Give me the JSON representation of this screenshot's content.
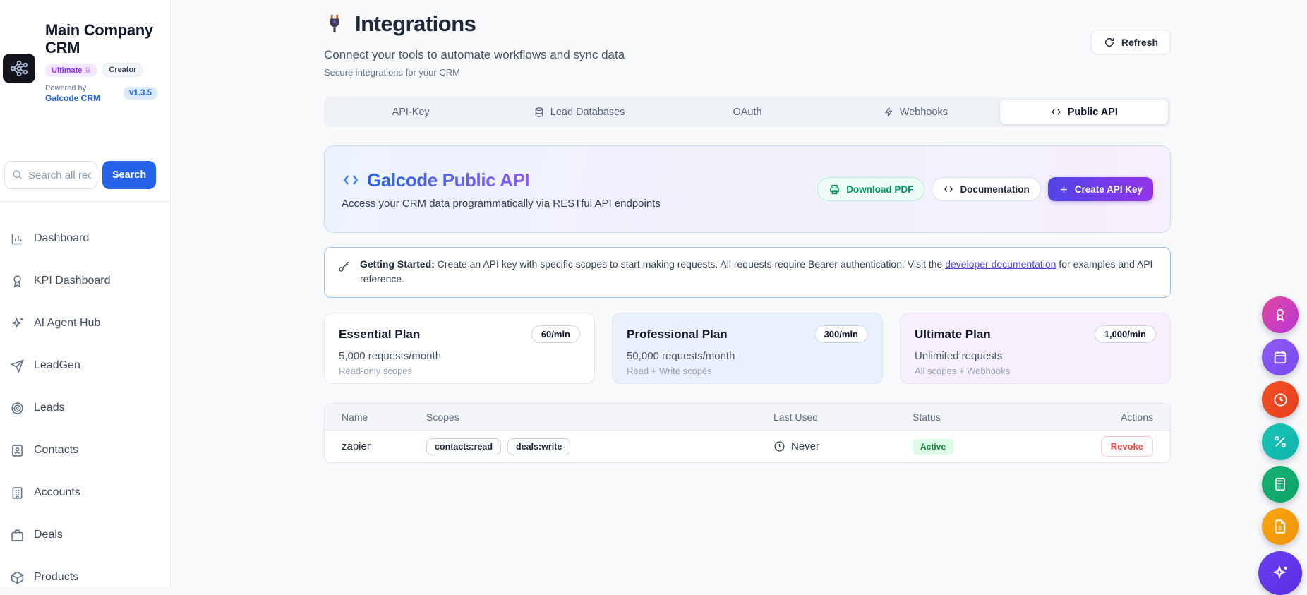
{
  "sidebar": {
    "title": "Main Company CRM",
    "badges": [
      {
        "label": "Ultimate",
        "icon": "crown-icon"
      },
      {
        "label": "Creator"
      }
    ],
    "powered_by": "Powered by",
    "brand_link": "Galcode CRM",
    "version": "v1.3.5",
    "search": {
      "placeholder": "Search all records...",
      "button": "Search",
      "icon": "search-icon"
    },
    "nav": [
      {
        "label": "Dashboard",
        "icon": "bar-chart-icon"
      },
      {
        "label": "KPI Dashboard",
        "icon": "award-icon"
      },
      {
        "label": "AI Agent Hub",
        "icon": "sparkles-icon"
      },
      {
        "label": "LeadGen",
        "icon": "send-icon"
      },
      {
        "label": "Leads",
        "icon": "target-icon"
      },
      {
        "label": "Contacts",
        "icon": "contact-card-icon"
      },
      {
        "label": "Accounts",
        "icon": "building-icon"
      },
      {
        "label": "Deals",
        "icon": "briefcase-icon"
      },
      {
        "label": "Products",
        "icon": "box-icon"
      }
    ]
  },
  "header": {
    "icon": "plug-icon",
    "title": "Integrations",
    "subtitle": "Connect your tools to automate workflows and sync data",
    "caption": "Secure integrations for your CRM",
    "refresh_label": "Refresh",
    "refresh_icon": "refresh-icon"
  },
  "tabs": [
    {
      "label": "API-Key"
    },
    {
      "label": "Lead Databases",
      "icon": "database-icon"
    },
    {
      "label": "OAuth"
    },
    {
      "label": "Webhooks",
      "icon": "zap-icon"
    },
    {
      "label": "Public API",
      "icon": "code-icon",
      "active": true
    }
  ],
  "hero": {
    "icon": "code-icon",
    "title": "Galcode Public API",
    "subtitle": "Access your CRM data programmatically via RESTful API endpoints",
    "buttons": {
      "download": "Download PDF",
      "documentation": "Documentation",
      "create": "Create API Key"
    },
    "accent_gradient": [
      "#2563eb",
      "#8b5cf6"
    ]
  },
  "getting_started": {
    "icon": "key-icon",
    "label_bold": "Getting Started:",
    "text_1": " Create an API key with specific scopes to start making requests. All requests require Bearer authentication. Visit the ",
    "link_text": "developer documentation",
    "text_2": " for examples and API reference."
  },
  "plans": [
    {
      "name": "Essential Plan",
      "rate": "60/min",
      "requests": "5,000 requests/month",
      "scopes": "Read-only scopes"
    },
    {
      "name": "Professional Plan",
      "rate": "300/min",
      "requests": "50,000 requests/month",
      "scopes": "Read + Write scopes"
    },
    {
      "name": "Ultimate Plan",
      "rate": "1,000/min",
      "requests": "Unlimited requests",
      "scopes": "All scopes + Webhooks"
    }
  ],
  "table": {
    "headers": [
      "Name",
      "Scopes",
      "Last Used",
      "Status",
      "Actions"
    ],
    "rows": [
      {
        "name": "zapier",
        "scopes": [
          "contacts:read",
          "deals:write"
        ],
        "last_used": "Never",
        "last_used_icon": "clock-icon",
        "status": "Active",
        "action": "Revoke"
      }
    ]
  },
  "fab_buttons": [
    {
      "icon": "award-icon",
      "color1": "#e0489f",
      "color2": "#b837d6"
    },
    {
      "icon": "calendar-icon",
      "color1": "#8e5cf7",
      "color2": "#7a49ee"
    },
    {
      "icon": "clock-icon",
      "color1": "#f25022",
      "color2": "#e73f1f"
    },
    {
      "icon": "percent-icon",
      "color1": "#18c5b4",
      "color2": "#0fb3ab"
    },
    {
      "icon": "calculator-icon",
      "color1": "#16b273",
      "color2": "#0da463"
    },
    {
      "icon": "file-text-icon",
      "color1": "#f8a60f",
      "color2": "#f0930a"
    },
    {
      "icon": "sparkles-icon",
      "color1": "#6a3df2",
      "color2": "#5a2fe0"
    }
  ],
  "colors": {
    "primary_blue": "#2563eb",
    "link_purple": "#4f46e5",
    "active_badge_bg": "#dcfce7",
    "active_badge_text": "#15803d",
    "revoke_red": "#ef4444",
    "create_gradient": [
      "#4f46e5",
      "#9333ea"
    ]
  }
}
